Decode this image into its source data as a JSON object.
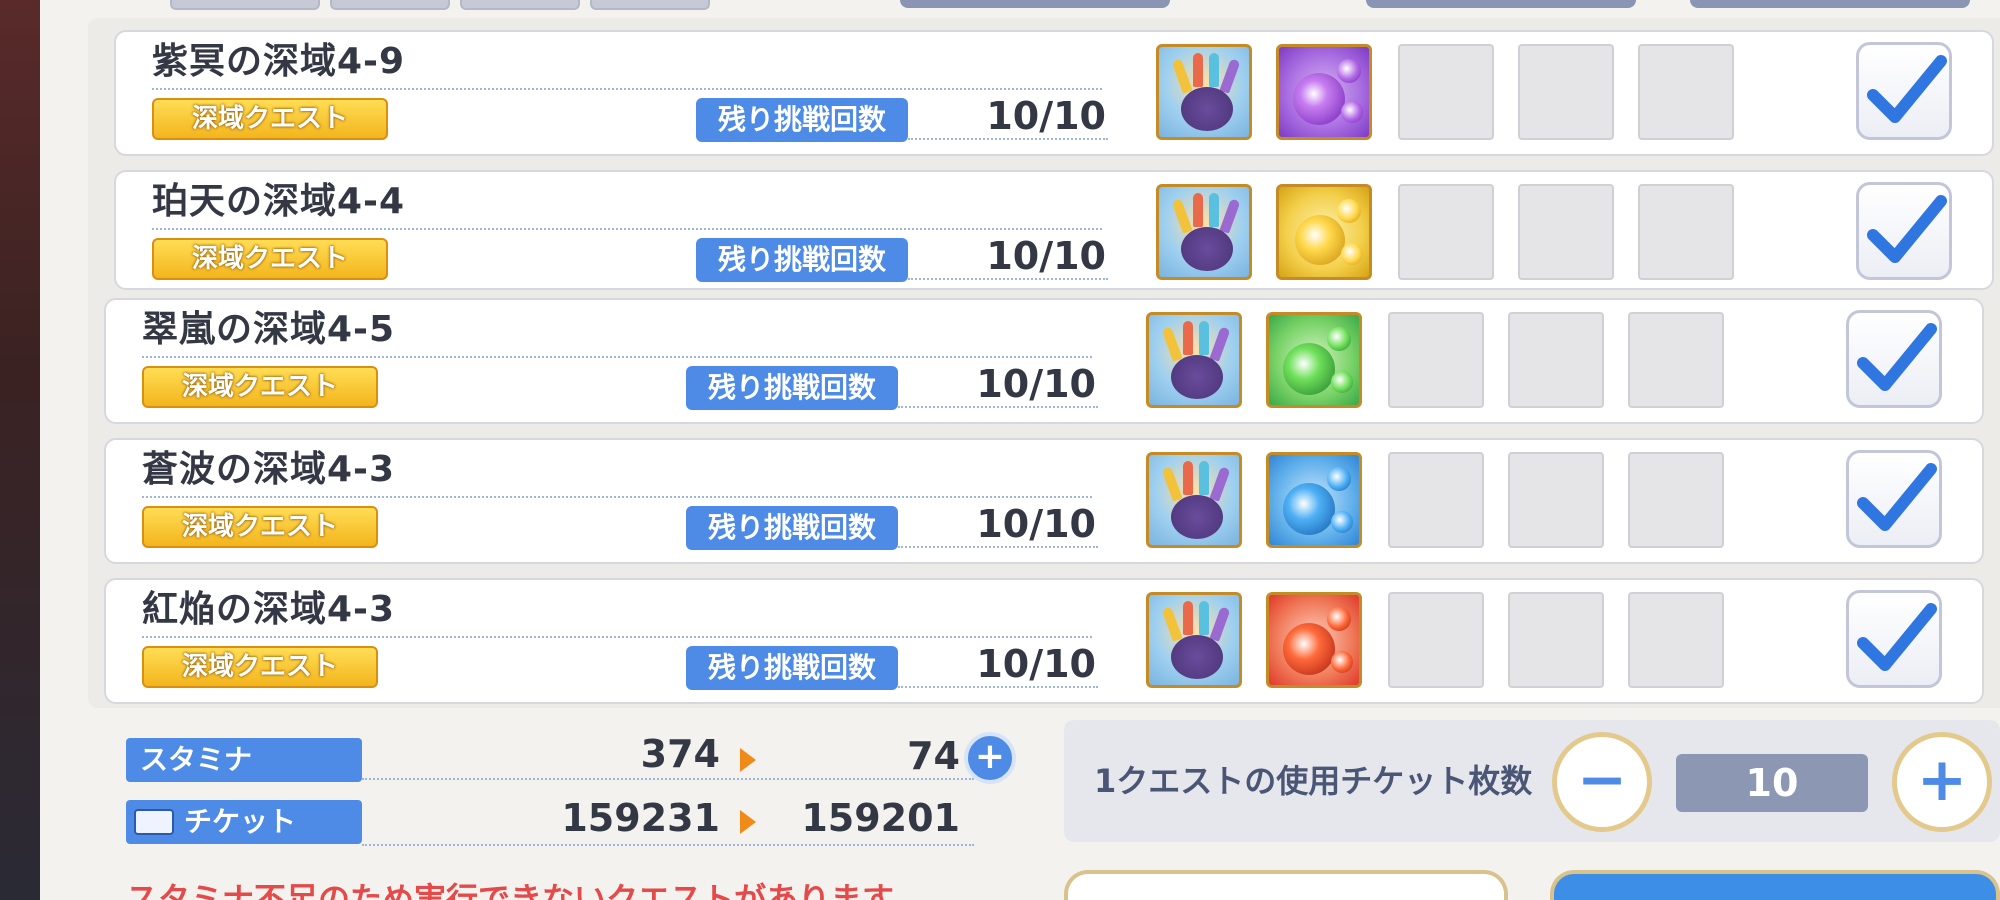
{
  "quests": [
    {
      "title": "紫冥の深域4-9",
      "tag": "深域クエスト",
      "remain_label": "残り挑戦回数",
      "remain_value": "10/10",
      "reward_icons": [
        "rainbow-claw-icon",
        "purple-orb-icon"
      ],
      "checked": true
    },
    {
      "title": "珀天の深域4-4",
      "tag": "深域クエスト",
      "remain_label": "残り挑戦回数",
      "remain_value": "10/10",
      "reward_icons": [
        "rainbow-claw-icon",
        "yellow-orb-icon"
      ],
      "checked": true
    },
    {
      "title": "翠嵐の深域4-5",
      "tag": "深域クエスト",
      "remain_label": "残り挑戦回数",
      "remain_value": "10/10",
      "reward_icons": [
        "rainbow-claw-icon",
        "green-orb-icon"
      ],
      "checked": true
    },
    {
      "title": "蒼波の深域4-3",
      "tag": "深域クエスト",
      "remain_label": "残り挑戦回数",
      "remain_value": "10/10",
      "reward_icons": [
        "rainbow-claw-icon",
        "blue-orb-icon"
      ],
      "checked": true
    },
    {
      "title": "紅焔の深域4-3",
      "tag": "深域クエスト",
      "remain_label": "残り挑戦回数",
      "remain_value": "10/10",
      "reward_icons": [
        "rainbow-claw-icon",
        "red-orb-icon"
      ],
      "checked": true
    }
  ],
  "stamina": {
    "label": "スタミナ",
    "current": "374",
    "after": "74"
  },
  "ticket": {
    "label": "チケット",
    "current": "159231",
    "after": "159201"
  },
  "ticket_use": {
    "label": "1クエストの使用チケット枚数",
    "minus": "−",
    "value": "10",
    "plus": "+"
  },
  "warning": "スタミナ不足のため実行できないクエストがあります",
  "colors": {
    "accent_blue": "#4d8be6",
    "tag_yellow": "#f3b51d",
    "warning_red": "#e54a4a",
    "orb_purple": "#8b3fd6",
    "orb_yellow": "#e8b514",
    "orb_green": "#3aa846",
    "orb_blue": "#2f86d6",
    "orb_red": "#e0392a"
  }
}
